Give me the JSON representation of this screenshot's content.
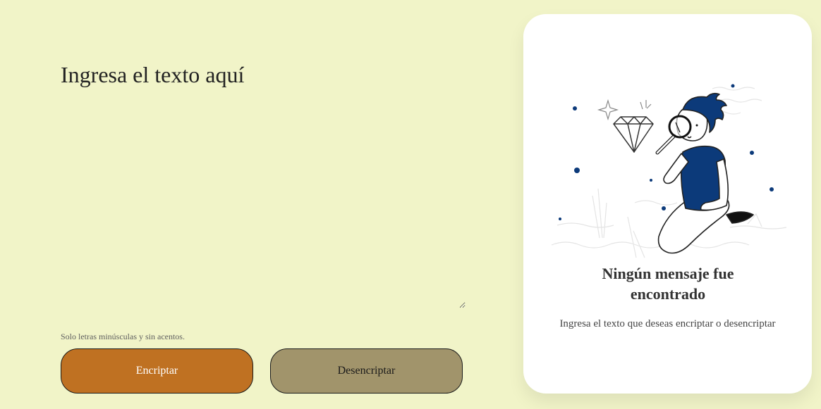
{
  "input": {
    "placeholder": "Ingresa el texto aquí",
    "value": ""
  },
  "hint": {
    "icon": "info-icon",
    "text": "Solo letras minúsculas y sin acentos."
  },
  "buttons": {
    "encrypt_label": "Encriptar",
    "decrypt_label": "Desencriptar"
  },
  "result": {
    "illustration": "person-magnifying-glass-diamond",
    "title": "Ningún mensaje fue encontrado",
    "subtitle": "Ingresa el texto que deseas encriptar o desencriptar"
  },
  "colors": {
    "background": "#f1f4c8",
    "encrypt_button": "#bf7122",
    "decrypt_button": "#a1946b",
    "card": "#ffffff",
    "illustration_accent": "#0c3a7a"
  }
}
